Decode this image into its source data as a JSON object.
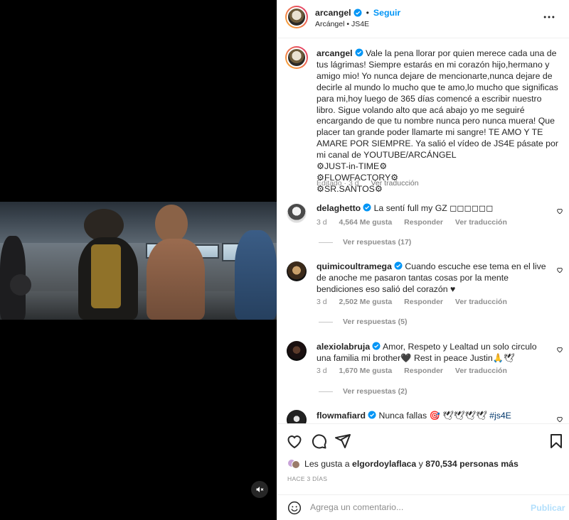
{
  "header": {
    "username": "arcangel",
    "dot": "•",
    "follow_label": "Seguir",
    "subtitle": "Arcángel • JS4E",
    "more_icon": "more-horizontal-icon"
  },
  "caption": {
    "username": "arcangel",
    "text": "Vale la pena llorar por quien merece cada una de tus lágrimas! Siempre estarás en mi corazón hijo,hermano y amigo mio! Yo nunca dejare de mencionarte,nunca dejare de decirle al mundo lo mucho que te amo,lo mucho que significas para mi,hoy luego de 365 días comencé a escribir nuestro libro. Sigue volando alto que acá abajo yo me seguiré encargando de que tu nombre nunca pero nunca muera! Que placer tan grande poder llamarte mi sangre! TE AMO Y TE AMARE POR SIEMPRE. Ya salió el vídeo de JS4E pásate por mi canal de YOUTUBE/ARCÁNGEL",
    "line1": "⚙JUST-in-TIME⚙",
    "line2": "⚙FLOWFACTORY⚙",
    "line3": "⚙SR.SANTOS⚙",
    "edited": "Editado · 3 d",
    "translation": "Ver traducción"
  },
  "comments": [
    {
      "username": "delaghetto",
      "text": "La sentí full my GZ ◻◻◻◻◻◻",
      "age": "3 d",
      "likes": "4,564 Me gusta",
      "reply": "Responder",
      "translate": "Ver traducción",
      "replies": "Ver respuestas (17)"
    },
    {
      "username": "quimicoultramega",
      "text": "Cuando escuche ese tema en el live de anoche me pasaron tantas cosas por la mente bendiciones eso salió del corazón ♥",
      "age": "3 d",
      "likes": "2,502 Me gusta",
      "reply": "Responder",
      "translate": "Ver traducción",
      "replies": "Ver respuestas (5)"
    },
    {
      "username": "alexiolabruja",
      "text": "Amor, Respeto y Lealtad un solo circulo una familia mi brother🖤 Rest in peace Justin🙏🕊",
      "age": "3 d",
      "likes": "1,670 Me gusta",
      "reply": "Responder",
      "translate": "Ver traducción",
      "replies": "Ver respuestas (2)"
    },
    {
      "username": "flowmafiard",
      "text": "Nunca fallas 🎯 🕊🕊🕊🕊",
      "hashtag": "#js4E"
    }
  ],
  "actions": {
    "like_icon": "heart-icon",
    "comment_icon": "comment-icon",
    "share_icon": "send-icon",
    "save_icon": "bookmark-icon",
    "likes_prefix": "Les gusta a",
    "likes_user": "elgordoylaflaca",
    "likes_and": "y",
    "likes_count": "870,534 personas más",
    "time_ago": "HACE 3 DÍAS"
  },
  "comment_box": {
    "placeholder": "Agrega un comentario...",
    "post_label": "Publicar",
    "emoji_icon": "smiley-icon"
  },
  "media": {
    "mute_icon": "speaker-muted-icon"
  },
  "colors": {
    "accent": "#0095f6",
    "verified": "#0095f6",
    "text": "#262626",
    "muted": "#8e8e8e"
  }
}
